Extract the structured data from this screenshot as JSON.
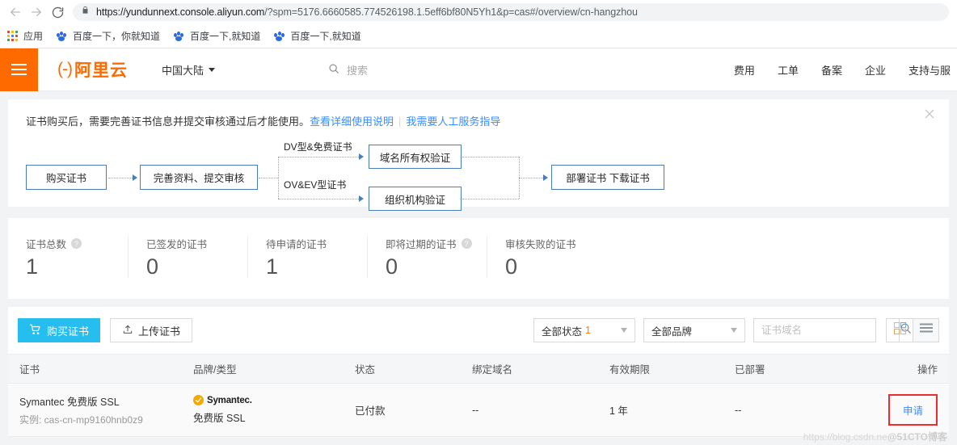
{
  "browser": {
    "back_icon": "back-arrow-icon",
    "forward_icon": "forward-arrow-icon",
    "reload_icon": "reload-icon",
    "lock_icon": "lock-icon",
    "url_host": "https://yundunnext.console.aliyun.com",
    "url_path": "/?spm=5176.6660585.774526198.1.5eff6bf80N5Yh1&p=cas#/overview/cn-hangzhou",
    "bookmarks": [
      {
        "label": "应用",
        "icon": "apps-grid-icon"
      },
      {
        "label": "百度一下，你就知道",
        "icon": "baidu-paw-icon"
      },
      {
        "label": "百度一下,就知道",
        "icon": "baidu-paw-icon"
      },
      {
        "label": "百度一下,就知道",
        "icon": "baidu-paw-icon"
      }
    ]
  },
  "header": {
    "menu_icon": "hamburger-menu-icon",
    "logo_mark": "(-)",
    "logo_text": "阿里云",
    "region": "中国大陆",
    "search_placeholder": "搜索",
    "search_icon": "search-icon",
    "nav": [
      "费用",
      "工单",
      "备案",
      "企业",
      "支持与服"
    ],
    "accent": "#ff6a00"
  },
  "notice": {
    "text": "证书购买后，需要完善证书信息并提交审核通过后才能使用。",
    "link1": "查看详细使用说明",
    "link2": "我需要人工服务指导",
    "close_icon": "close-icon",
    "link_color": "#3b8cff"
  },
  "flow": {
    "boxes": [
      {
        "label": "购买证书"
      },
      {
        "label": "完善资料、提交审核"
      },
      {
        "label": "域名所有权验证"
      },
      {
        "label": "组织机构验证"
      },
      {
        "label": "部署证书  下载证书"
      }
    ],
    "labels": [
      "DV型&免费证书",
      "OV&EV型证书"
    ],
    "border_color": "#4a7ebb"
  },
  "stats": [
    {
      "label": "证书总数",
      "value": "1",
      "help": true
    },
    {
      "label": "已签发的证书",
      "value": "0",
      "help": false
    },
    {
      "label": "待申请的证书",
      "value": "1",
      "help": false
    },
    {
      "label": "即将过期的证书",
      "value": "0",
      "help": true
    },
    {
      "label": "审核失败的证书",
      "value": "0",
      "help": false
    }
  ],
  "toolbar": {
    "buy_label": "购买证书",
    "buy_icon": "cart-icon",
    "upload_label": "上传证书",
    "upload_icon": "upload-icon",
    "status_filter": "全部状态",
    "status_count": "1",
    "brand_filter": "全部品牌",
    "search_placeholder": "证书域名",
    "search_icon": "search-icon",
    "grid_view_icon": "grid-view-icon",
    "list_view_icon": "list-view-icon",
    "buy_color": "#26bdef"
  },
  "table": {
    "columns": [
      "证书",
      "品牌/类型",
      "状态",
      "绑定域名",
      "有效期限",
      "已部署",
      "操作"
    ],
    "rows": [
      {
        "cert_name": "Symantec 免费版 SSL",
        "cert_instance": "实例: cas-cn-mp9160hnb0z9",
        "brand_logo_text": "Symantec.",
        "brand_type": "免费版 SSL",
        "status": "已付款",
        "domain": "--",
        "validity": "1 年",
        "deployed": "--",
        "action": "申请"
      }
    ]
  },
  "watermark": {
    "prefix": "https://blog.csdn.ne",
    "suffix": "@51CTO博客"
  }
}
